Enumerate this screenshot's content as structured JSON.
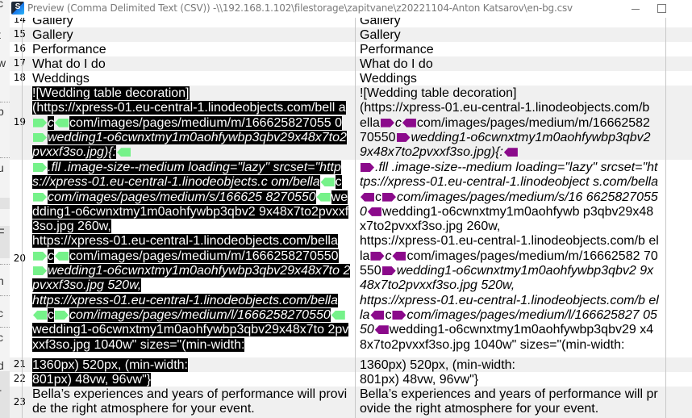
{
  "window": {
    "title": "Preview (Comma Delimited Text (CSV)) -\\\\192.168.1.102\\filestorage\\zapitvane\\z20221104-Anton Katsarov\\en-bg.csv",
    "app_icon_letter": "S",
    "buttons": [
      "minimize",
      "maximize"
    ]
  },
  "background_window_fragments": [
    "c",
    "t",
    "w",
    "p",
    "u",
    "F",
    "n",
    "c",
    "c",
    "d",
    "r"
  ],
  "colors": {
    "tag_source": "#76f28a",
    "tag_target": "#8b0a8b",
    "selection_bg": "#000000",
    "row_alt_bg": "#f0f0f0"
  },
  "rows": [
    {
      "num": "14",
      "source": "Gallery",
      "target": "Gallery"
    },
    {
      "num": "15",
      "source": "Gallery",
      "target": "Gallery"
    },
    {
      "num": "16",
      "source": "Performance",
      "target": "Performance"
    },
    {
      "num": "17",
      "source": "What do I do",
      "target": "What do I do"
    },
    {
      "num": "18",
      "source": "Weddings",
      "target": "Weddings"
    },
    {
      "num": "19",
      "source_parts": [
        {
          "t": "![Wedding table decoration]\n(https://xpress-01.eu-central-1.linodeobjects.com/bell a"
        },
        {
          "tag": "open"
        },
        {
          "t": "c",
          "i": true
        },
        {
          "tag": "close"
        },
        {
          "t": "com/images/pages/medium/m/166625827055 0"
        },
        {
          "tag": "open"
        },
        {
          "t": "wedding1-o6cwnxtmy1m0aohfywbp3qbv29x48x7to2pvxxf3so.jpg){:",
          "i": true
        },
        {
          "tag": "close"
        }
      ],
      "target_parts": [
        {
          "t": "![Wedding table decoration]\n(https://xpress-01.eu-central-1.linodeobjects.com/b ella"
        },
        {
          "tag": "open"
        },
        {
          "t": "c",
          "i": true
        },
        {
          "tag": "close"
        },
        {
          "t": "com/images/pages/medium/m/16662582 70550"
        },
        {
          "tag": "open"
        },
        {
          "t": "wedding1-o6cwnxtmy1m0aohfywbp3qbv2 9x48x7to2pvxxf3so.jpg){:",
          "i": true
        },
        {
          "tag": "close"
        }
      ]
    },
    {
      "num": "20",
      "source_parts": [
        {
          "tag": "open"
        },
        {
          "t": ".fll .image-size--medium loading=\"lazy\" srcset=\"https://xpress-01.eu-central-1.linodeobjects.c om/bella",
          "i": true
        },
        {
          "tag": "close"
        },
        {
          "t": "c"
        },
        {
          "tag": "open"
        },
        {
          "t": "com/images/pages/medium/s/166625 8270550",
          "i": true
        },
        {
          "tag": "close"
        },
        {
          "t": "wedding1-o6cwnxtmy1m0aohfywbp3qbv2 9x48x7to2pvxxf3so.jpg 260w,\nhttps://xpress-01.eu-central-1.linodeobjects.com/bella"
        },
        {
          "tag": "open"
        },
        {
          "t": "c",
          "i": true
        },
        {
          "tag": "close"
        },
        {
          "t": "com/images/pages/medium/m/1666258270550"
        },
        {
          "tag": "open"
        },
        {
          "t": "wedding1-o6cwnxtmy1m0aohfywbp3qbv29x48x7to 2pvxxf3so.jpg 520w,\nhttps://xpress-01.eu-central-1.linodeobjects.com/bella",
          "i": true
        },
        {
          "tag": "close"
        },
        {
          "t": "c"
        },
        {
          "tag": "open"
        },
        {
          "t": "com/images/pages/medium/l/1666258270550",
          "i": true
        },
        {
          "tag": "close"
        },
        {
          "t": "wedding1-o6cwnxtmy1m0aohfywbp3qbv29x48x7to 2pvxxf3so.jpg 1040w\" sizes=\"(min-width:"
        }
      ],
      "target_parts": [
        {
          "tag": "open"
        },
        {
          "t": ".fll .image-size--medium loading=\"lazy\" srcset=\"https://xpress-01.eu-central-1.linodeobject s.com/bella",
          "i": true
        },
        {
          "tag": "close"
        },
        {
          "t": "c"
        },
        {
          "tag": "open"
        },
        {
          "t": "com/images/pages/medium/s/16 66258270550",
          "i": true
        },
        {
          "tag": "close"
        },
        {
          "t": "wedding1-o6cwnxtmy1m0aohfywb p3qbv29x48x7to2pvxxf3so.jpg 260w,\nhttps://xpress-01.eu-central-1.linodeobjects.com/b ella"
        },
        {
          "tag": "open"
        },
        {
          "t": "c",
          "i": true
        },
        {
          "tag": "close"
        },
        {
          "t": "com/images/pages/medium/m/16662582 70550"
        },
        {
          "tag": "open"
        },
        {
          "t": "wedding1-o6cwnxtmy1m0aohfywbp3qbv2 9x48x7to2pvxxf3so.jpg 520w,\nhttps://xpress-01.eu-central-1.linodeobjects.com/b ella",
          "i": true
        },
        {
          "tag": "close"
        },
        {
          "t": "c"
        },
        {
          "tag": "open"
        },
        {
          "t": "com/images/pages/medium/l/166625827 0550",
          "i": true
        },
        {
          "tag": "close"
        },
        {
          "t": "wedding1-o6cwnxtmy1m0aohfywbp3qbv29 x48x7to2pvxxf3so.jpg 1040w\" sizes=\"(min-width:"
        }
      ]
    },
    {
      "num": "21",
      "source": "1360px) 520px, (min-width:",
      "target": "1360px) 520px, (min-width:"
    },
    {
      "num": "22",
      "source": "801px) 48vw, 96vw\"}",
      "target": "801px) 48vw, 96vw\"}"
    },
    {
      "num": "23",
      "source": "Bella’s experiences and years of performance will provide the right atmosphere for your event.",
      "target": "Bella’s experiences and years of performance will provide the right atmosphere for your event."
    }
  ]
}
